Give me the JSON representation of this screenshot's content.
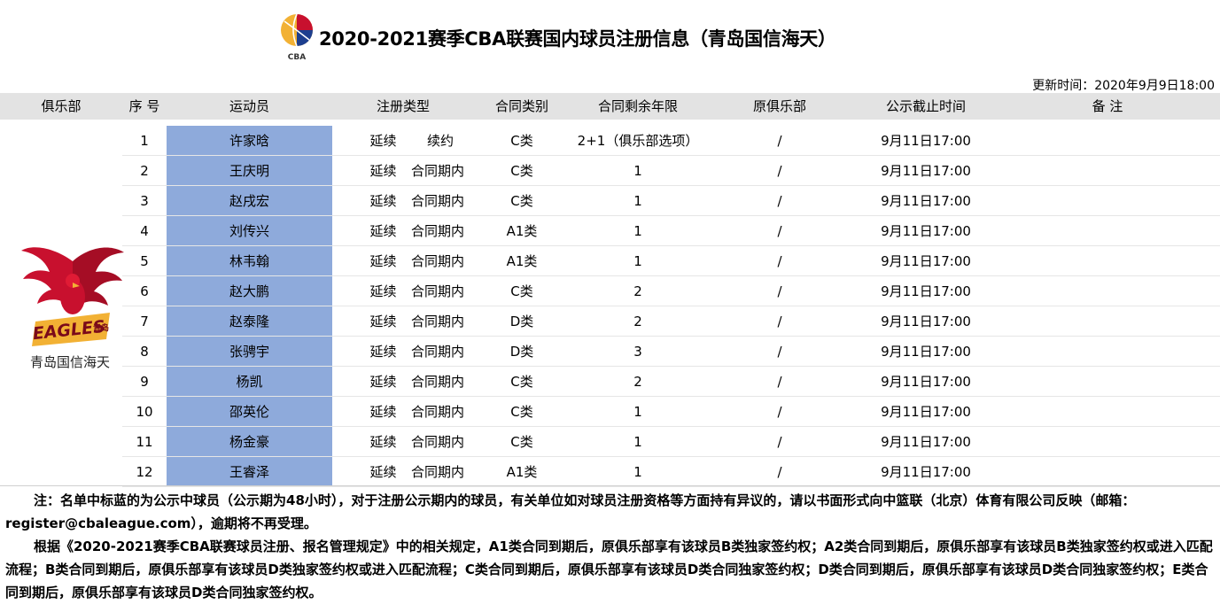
{
  "header": {
    "logo_text": "CBA",
    "title": "2020-2021赛季CBA联赛国内球员注册信息（青岛国信海天）",
    "updated": "更新时间：2020年9月9日18:00"
  },
  "columns": [
    "俱乐部",
    "序 号",
    "运动员",
    "注册类型",
    "合同类别",
    "合同剩余年限",
    "原俱乐部",
    "公示截止时间",
    "备 注"
  ],
  "club": {
    "name": "青岛国信海天",
    "logo_text": "EAGLES",
    "logo_cn": "青岛",
    "colors": {
      "red": "#c8102e",
      "gold": "#f2b134"
    }
  },
  "rows": [
    {
      "no": "1",
      "player": "许家晗",
      "reg_type": "延续",
      "reg_sub": "续约",
      "contract": "C类",
      "years": "2+1（俱乐部选项）",
      "prev_club": "/",
      "deadline": "9月11日17:00",
      "note": "",
      "highlight": true
    },
    {
      "no": "2",
      "player": "王庆明",
      "reg_type": "延续",
      "reg_sub": "合同期内",
      "contract": "C类",
      "years": "1",
      "prev_club": "/",
      "deadline": "9月11日17:00",
      "note": "",
      "highlight": true
    },
    {
      "no": "3",
      "player": "赵戌宏",
      "reg_type": "延续",
      "reg_sub": "合同期内",
      "contract": "C类",
      "years": "1",
      "prev_club": "/",
      "deadline": "9月11日17:00",
      "note": "",
      "highlight": true
    },
    {
      "no": "4",
      "player": "刘传兴",
      "reg_type": "延续",
      "reg_sub": "合同期内",
      "contract": "A1类",
      "years": "1",
      "prev_club": "/",
      "deadline": "9月11日17:00",
      "note": "",
      "highlight": true
    },
    {
      "no": "5",
      "player": "林韦翰",
      "reg_type": "延续",
      "reg_sub": "合同期内",
      "contract": "A1类",
      "years": "1",
      "prev_club": "/",
      "deadline": "9月11日17:00",
      "note": "",
      "highlight": true
    },
    {
      "no": "6",
      "player": "赵大鹏",
      "reg_type": "延续",
      "reg_sub": "合同期内",
      "contract": "C类",
      "years": "2",
      "prev_club": "/",
      "deadline": "9月11日17:00",
      "note": "",
      "highlight": true
    },
    {
      "no": "7",
      "player": "赵泰隆",
      "reg_type": "延续",
      "reg_sub": "合同期内",
      "contract": "D类",
      "years": "2",
      "prev_club": "/",
      "deadline": "9月11日17:00",
      "note": "",
      "highlight": true
    },
    {
      "no": "8",
      "player": "张骋宇",
      "reg_type": "延续",
      "reg_sub": "合同期内",
      "contract": "D类",
      "years": "3",
      "prev_club": "/",
      "deadline": "9月11日17:00",
      "note": "",
      "highlight": true
    },
    {
      "no": "9",
      "player": "杨凯",
      "reg_type": "延续",
      "reg_sub": "合同期内",
      "contract": "C类",
      "years": "2",
      "prev_club": "/",
      "deadline": "9月11日17:00",
      "note": "",
      "highlight": true
    },
    {
      "no": "10",
      "player": "邵英伦",
      "reg_type": "延续",
      "reg_sub": "合同期内",
      "contract": "C类",
      "years": "1",
      "prev_club": "/",
      "deadline": "9月11日17:00",
      "note": "",
      "highlight": true
    },
    {
      "no": "11",
      "player": "杨金豪",
      "reg_type": "延续",
      "reg_sub": "合同期内",
      "contract": "C类",
      "years": "1",
      "prev_club": "/",
      "deadline": "9月11日17:00",
      "note": "",
      "highlight": true
    },
    {
      "no": "12",
      "player": "王睿泽",
      "reg_type": "延续",
      "reg_sub": "合同期内",
      "contract": "A1类",
      "years": "1",
      "prev_club": "/",
      "deadline": "9月11日17:00",
      "note": "",
      "highlight": true
    }
  ],
  "footnotes": [
    "注：名单中标蓝的为公示中球员（公示期为48小时），对于注册公示期内的球员，有关单位如对球员注册资格等方面持有异议的，请以书面形式向中篮联（北京）体育有限公司反映（邮箱：register@cbaleague.com），逾期将不再受理。",
    "根据《2020-2021赛季CBA联赛球员注册、报名管理规定》中的相关规定，A1类合同到期后，原俱乐部享有该球员B类独家签约权；A2类合同到期后，原俱乐部享有该球员B类独家签约权或进入匹配流程；B类合同到期后，原俱乐部享有该球员D类独家签约权或进入匹配流程；C类合同到期后，原俱乐部享有该球员D类合同独家签约权；D类合同到期后，原俱乐部享有该球员D类合同独家签约权；E类合同到期后，原俱乐部享有该球员D类合同独家签约权。"
  ],
  "colors": {
    "highlight": "#8eaadb",
    "header_bg": "#e3e3e3",
    "cba_red": "#c8102e",
    "cba_blue": "#1d3f8f",
    "cba_gold": "#f2b134"
  }
}
